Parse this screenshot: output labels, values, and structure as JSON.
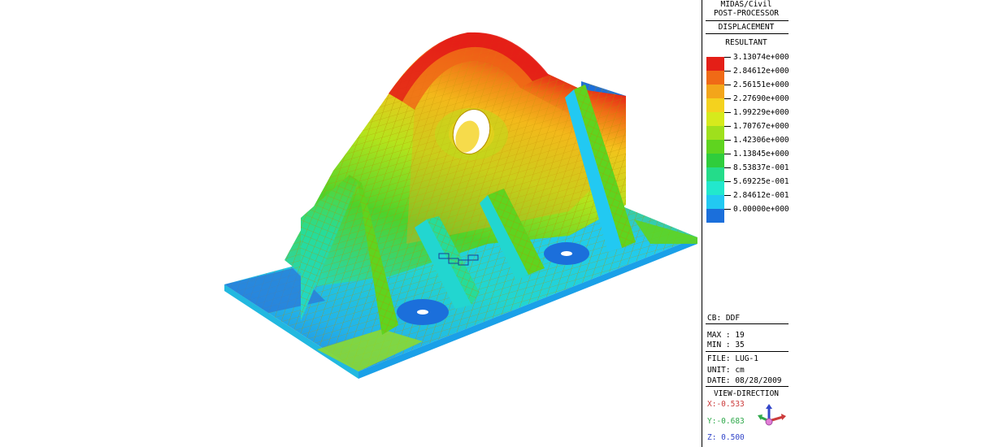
{
  "panel": {
    "program": "MIDAS/Civil",
    "module": "POST-PROCESSOR",
    "result_type": "DISPLACEMENT",
    "component": "RESULTANT",
    "legend": [
      {
        "label": "3.13074e+000",
        "color": "#e41f17"
      },
      {
        "label": "2.84612e+000",
        "color": "#f06a16"
      },
      {
        "label": "2.56151e+000",
        "color": "#f3a51a"
      },
      {
        "label": "2.27690e+000",
        "color": "#f4d21e"
      },
      {
        "label": "1.99229e+000",
        "color": "#d6ea1c"
      },
      {
        "label": "1.70767e+000",
        "color": "#9fe01c"
      },
      {
        "label": "1.42306e+000",
        "color": "#5fd41f"
      },
      {
        "label": "1.13845e+000",
        "color": "#2fcd3c"
      },
      {
        "label": "8.53837e-001",
        "color": "#24dc8a"
      },
      {
        "label": "5.69225e-001",
        "color": "#22e8cd"
      },
      {
        "label": "2.84612e-001",
        "color": "#22c9f2"
      },
      {
        "label": "0.00000e+000",
        "color": "#1b6fdb"
      }
    ],
    "cb": "CB: DDF",
    "max": "MAX : 19",
    "min": "MIN : 35",
    "file": "FILE: LUG-1",
    "unit": "UNIT: cm",
    "date": "DATE: 08/28/2009",
    "view_direction": "VIEW-DIRECTION",
    "x_dir": "X:-0.533",
    "y_dir": "Y:-0.683",
    "z_dir": "Z: 0.500",
    "colors": {
      "x": "#cc3b3b",
      "y": "#2ea84a",
      "z": "#3346c9"
    }
  }
}
